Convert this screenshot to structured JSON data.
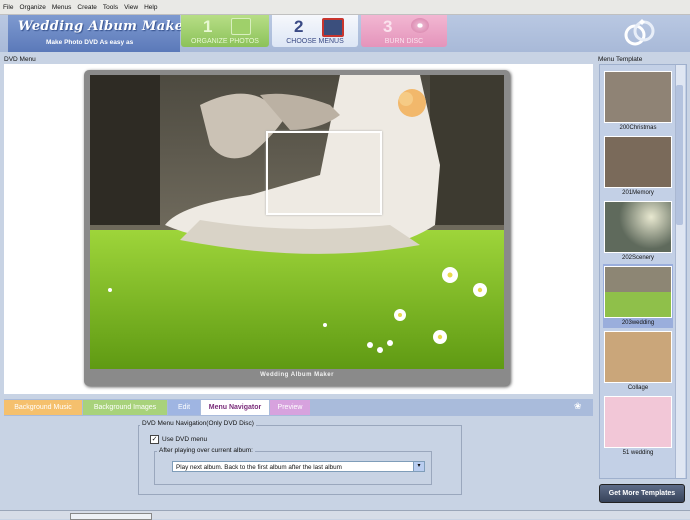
{
  "menu": [
    "File",
    "Organize",
    "Menus",
    "Create",
    "Tools",
    "View",
    "Help"
  ],
  "app": {
    "logo_title": "Wedding Album Maker Gold",
    "logo_subtitle": "Make Photo DVD As easy as"
  },
  "steps": [
    {
      "num": "1",
      "label": "ORGANIZE PHOTOS"
    },
    {
      "num": "2",
      "label": "CHOOSE MENUS"
    },
    {
      "num": "3",
      "label": "BURN DISC"
    }
  ],
  "dvd_menu": {
    "label": "DVD Menu",
    "caption": "Wedding Album Maker"
  },
  "templates": {
    "label": "Menu Template",
    "items": [
      {
        "name": "200Christmas",
        "thumb_color": "#8f8375"
      },
      {
        "name": "201Memory",
        "thumb_color": "#7a6a5a"
      },
      {
        "name": "202Scenery",
        "thumb_color": "#5f6a5c"
      },
      {
        "name": "203wedding",
        "thumb_color": "#8fc04a"
      },
      {
        "name": "Collage",
        "thumb_color": "#caa67a"
      },
      {
        "name": "51 wedding",
        "thumb_color": "#f2c7d7"
      }
    ],
    "more_button": "Get More Templates"
  },
  "tabs": [
    "Background Music",
    "Background Images",
    "Edit",
    "Menu Navigator",
    "Preview"
  ],
  "navigator": {
    "group_title": "DVD Menu Navigation(Only DVD Disc)",
    "use_dvd_menu": "Use DVD menu",
    "use_dvd_menu_checked": true,
    "after_title": "After playing over current album:",
    "after_value": "Play next album. Back to the first album after the last album"
  }
}
